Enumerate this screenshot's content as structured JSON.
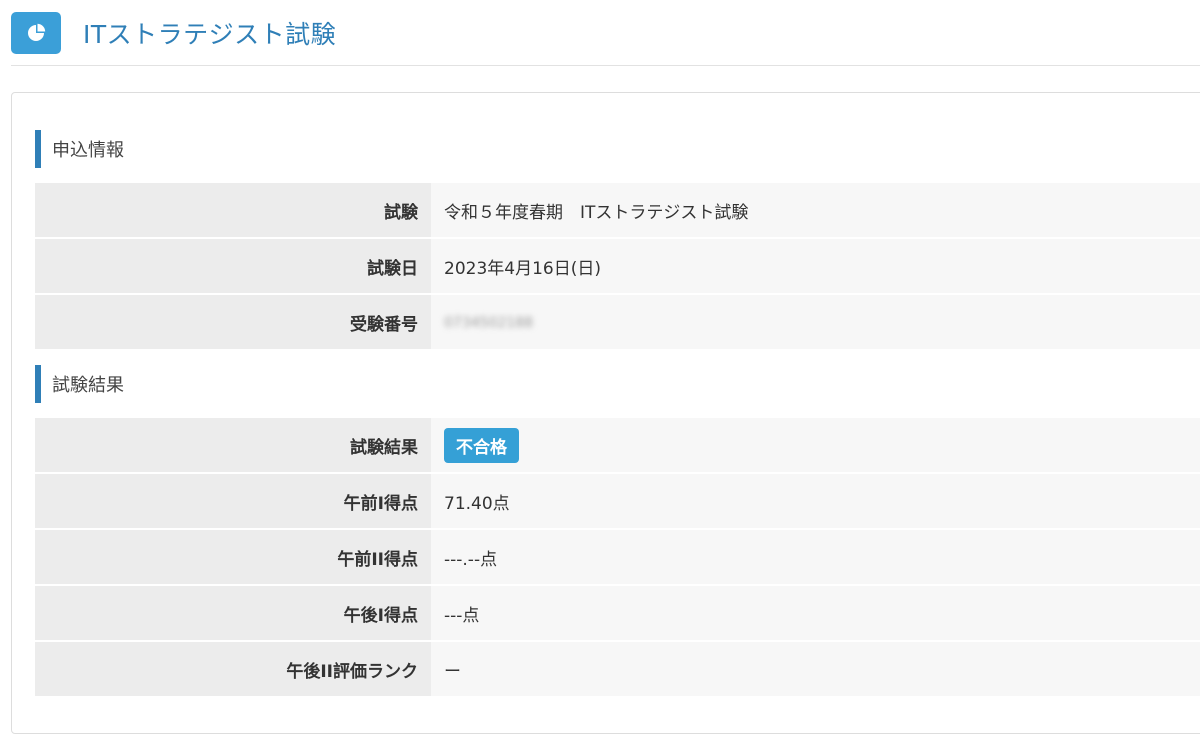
{
  "header": {
    "icon": "pie-chart-icon",
    "title": "ITストラテジスト試験"
  },
  "application_section": {
    "heading": "申込情報",
    "rows": [
      {
        "label": "試験",
        "value": "令和５年度春期　ITストラテジスト試験"
      },
      {
        "label": "試験日",
        "value": "2023年4月16日(日)"
      },
      {
        "label": "受験番号",
        "value": "0734502188"
      }
    ]
  },
  "result_section": {
    "heading": "試験結果",
    "result_label": "試験結果",
    "result_badge": "不合格",
    "badge_color": "#35a0d6",
    "rows": [
      {
        "label": "午前I得点",
        "value": "71.40点"
      },
      {
        "label": "午前II得点",
        "value": "---.--点"
      },
      {
        "label": "午後I得点",
        "value": "---点"
      },
      {
        "label": "午後II評価ランク",
        "value": "ー"
      }
    ]
  },
  "colors": {
    "accent": "#2f7fb7",
    "icon_bg": "#3b9fd8"
  }
}
